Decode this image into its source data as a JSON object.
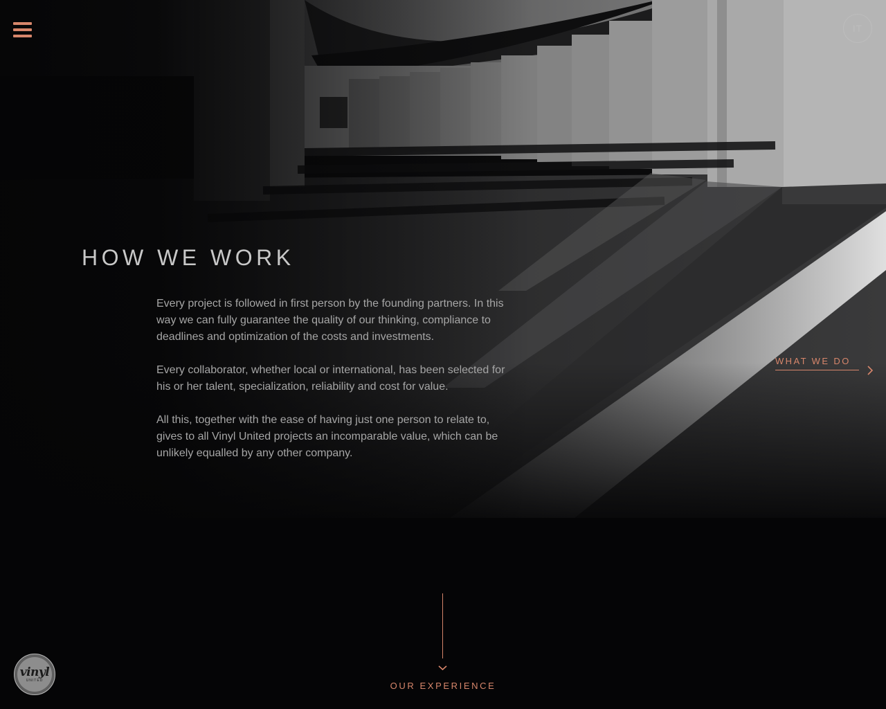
{
  "nav": {
    "menu_icon": "hamburger-menu-icon",
    "language_label": "IT"
  },
  "section": {
    "title": "HOW WE WORK",
    "paragraphs": [
      "Every project is followed in first person by the founding partners. In this way we can fully guarantee the quality of our thinking, compliance to deadlines and optimization of the costs and investments.",
      "Every collaborator, whether local or international, has been selected for his or her talent, specialization, reliability and cost for value.",
      "All this, together with the ease of having just one person to relate to, gives to all Vinyl United projects an incomparable value, which can be unlikely equalled by any other company."
    ]
  },
  "next_section": {
    "label": "WHAT WE DO",
    "icon": "chevron-right-icon"
  },
  "scroll": {
    "label": "OUR EXPERIENCE",
    "icon": "chevron-down-icon"
  },
  "logo": {
    "word": "vinyl",
    "sub": "UNITED"
  },
  "colors": {
    "accent": "#d7866b",
    "background": "#050506",
    "text": "#a6a6a6",
    "title": "#c8c8c8"
  }
}
